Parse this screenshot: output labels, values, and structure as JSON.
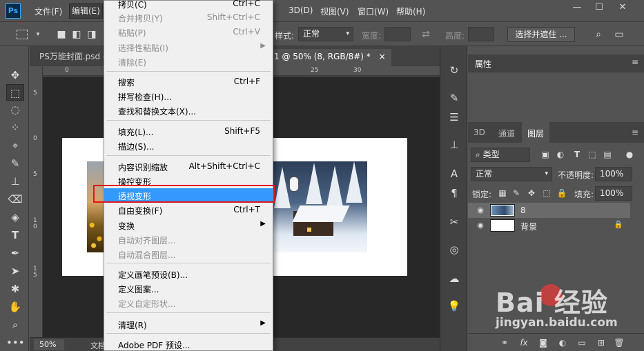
{
  "app": {
    "logo": "Ps"
  },
  "menubar": {
    "file": "文件(F)",
    "edit": "编辑(E)",
    "three_d": "3D(D)",
    "view": "视图(V)",
    "window": "窗口(W)",
    "help": "帮助(H)"
  },
  "window_controls": {
    "minimize": "—",
    "maximize": "☐",
    "close": "✕"
  },
  "options": {
    "style_label": "样式:",
    "style_value": "正常",
    "width_label": "宽度:",
    "height_label": "高度:",
    "select_mask_button": "选择并遮住 ..."
  },
  "document": {
    "tab1": "PS万能封面.psd @",
    "tab2": "1 @ 50% (8, RGB/8#) *",
    "tab_close": "×",
    "zoom": "50%",
    "status": "文档",
    "ruler_h": [
      "0",
      "25",
      "30"
    ],
    "ruler_v": [
      "5",
      "0",
      "5",
      "1\n0",
      "1\n5"
    ]
  },
  "properties_panel": {
    "tabs": {
      "properties": "属性"
    }
  },
  "layers_panel": {
    "tabs": {
      "three_d": "3D",
      "channels": "通道",
      "layers": "图层"
    },
    "filter_kind": "类型",
    "blend_mode": "正常",
    "opacity_label": "不透明度:",
    "opacity_value": "100%",
    "lock_label": "锁定:",
    "fill_label": "填充:",
    "fill_value": "100%",
    "layers": [
      {
        "name": "8",
        "selected": true
      },
      {
        "name": "背景",
        "selected": false
      }
    ]
  },
  "edit_menu": {
    "items": [
      {
        "label": "拷贝(C)",
        "shortcut": "Ctrl+C",
        "disabled": false
      },
      {
        "label": "合并拷贝(Y)",
        "shortcut": "Shift+Ctrl+C",
        "disabled": true
      },
      {
        "label": "粘贴(P)",
        "shortcut": "Ctrl+V",
        "disabled": true
      },
      {
        "label": "选择性粘贴(I)",
        "shortcut": "",
        "disabled": true
      },
      {
        "label": "清除(E)",
        "shortcut": "",
        "disabled": true
      },
      {
        "label": "搜索",
        "shortcut": "Ctrl+F",
        "disabled": false
      },
      {
        "label": "拼写检查(H)...",
        "shortcut": "",
        "disabled": false
      },
      {
        "label": "查找和替换文本(X)...",
        "shortcut": "",
        "disabled": false
      },
      {
        "label": "填充(L)...",
        "shortcut": "Shift+F5",
        "disabled": false
      },
      {
        "label": "描边(S)...",
        "shortcut": "",
        "disabled": false
      },
      {
        "label": "内容识别缩放",
        "shortcut": "Alt+Shift+Ctrl+C",
        "disabled": false
      },
      {
        "label": "操控变形",
        "shortcut": "",
        "disabled": false
      },
      {
        "label": "透视变形",
        "shortcut": "",
        "disabled": false
      },
      {
        "label": "自由变换(F)",
        "shortcut": "Ctrl+T",
        "disabled": false
      },
      {
        "label": "变换",
        "shortcut": "",
        "disabled": false
      },
      {
        "label": "自动对齐图层...",
        "shortcut": "",
        "disabled": true
      },
      {
        "label": "自动混合图层...",
        "shortcut": "",
        "disabled": true
      },
      {
        "label": "定义画笔预设(B)...",
        "shortcut": "",
        "disabled": false
      },
      {
        "label": "定义图案...",
        "shortcut": "",
        "disabled": false
      },
      {
        "label": "定义自定形状...",
        "shortcut": "",
        "disabled": true
      },
      {
        "label": "清理(R)",
        "shortcut": "",
        "disabled": false
      },
      {
        "label": "Adobe PDF 预设...",
        "shortcut": "",
        "disabled": false
      }
    ],
    "highlighted": "透视变形"
  },
  "watermark": {
    "brand": "Bai  经验",
    "url": "jingyan.baidu.com"
  }
}
